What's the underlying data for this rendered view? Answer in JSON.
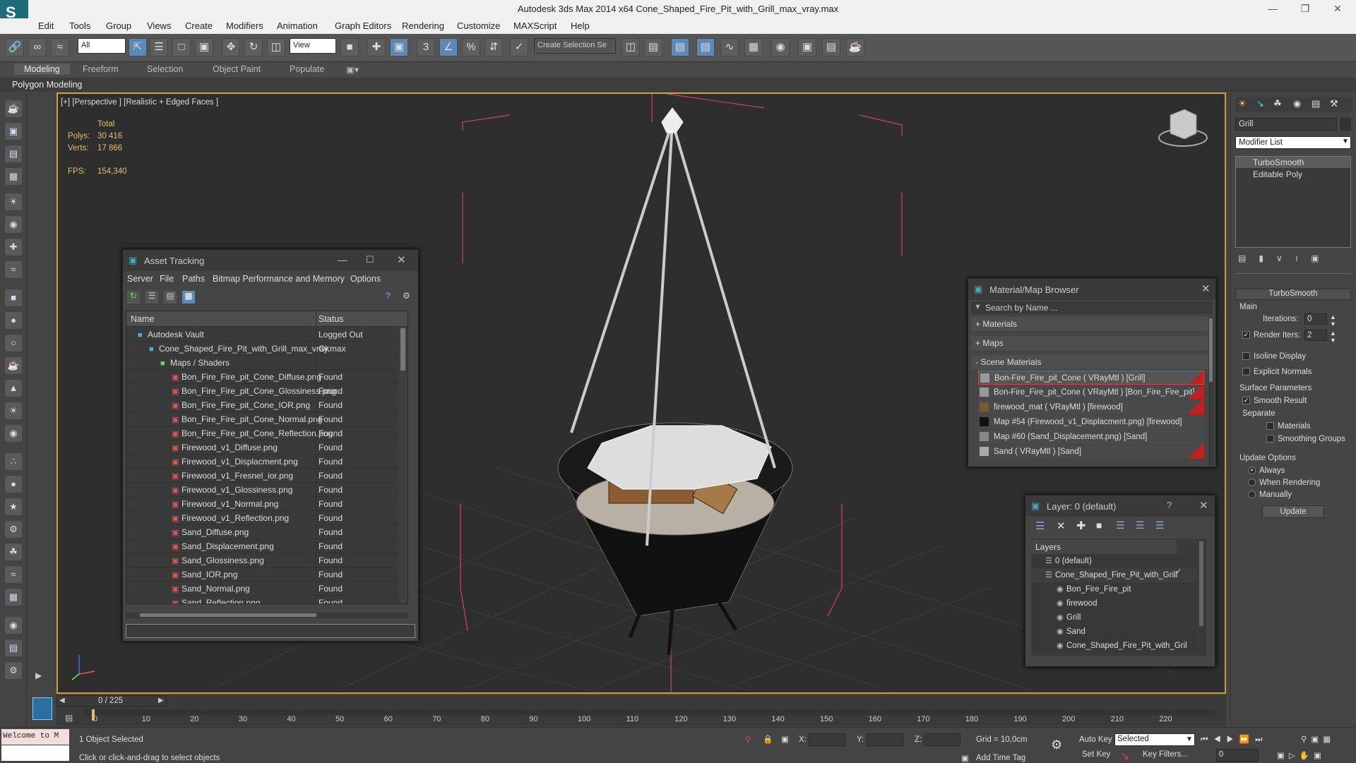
{
  "titlebar": {
    "title": "Autodesk 3ds Max  2014 x64     Cone_Shaped_Fire_Pit_with_Grill_max_vray.max"
  },
  "menubar": {
    "items": [
      "Edit",
      "Tools",
      "Group",
      "Views",
      "Create",
      "Modifiers",
      "Animation",
      "Graph Editors",
      "Rendering",
      "Customize",
      "MAXScript",
      "Help"
    ]
  },
  "toolbar": {
    "selection_filter": "All",
    "reference_coord": "View",
    "named_selection_placeholder": "Create Selection Se"
  },
  "ribbon": {
    "tabs": [
      "Modeling",
      "Freeform",
      "Selection",
      "Object Paint",
      "Populate"
    ],
    "subpanel": "Polygon Modeling"
  },
  "viewport": {
    "label": "[+] [Perspective ] [Realistic + Edged Faces ]",
    "stats": {
      "total_label": "Total",
      "polys_label": "Polys:",
      "polys": "30 416",
      "verts_label": "Verts:",
      "verts": "17 866",
      "fps_label": "FPS:",
      "fps": "154,340"
    }
  },
  "asset_tracking": {
    "title": "Asset Tracking",
    "menu": [
      "Server",
      "File",
      "Paths",
      "Bitmap Performance and Memory",
      "Options"
    ],
    "columns": [
      "Name",
      "Status"
    ],
    "rows": [
      {
        "name": "Autodesk Vault",
        "status": "Logged Out",
        "indent": 1
      },
      {
        "name": "Cone_Shaped_Fire_Pit_with_Grill_max_vray.max",
        "status": "Ok",
        "indent": 2
      },
      {
        "name": "Maps / Shaders",
        "status": "",
        "indent": 3
      },
      {
        "name": "Bon_Fire_Fire_pit_Cone_Diffuse.png",
        "status": "Found",
        "indent": 4
      },
      {
        "name": "Bon_Fire_Fire_pit_Cone_Glossiness.png",
        "status": "Found",
        "indent": 4
      },
      {
        "name": "Bon_Fire_Fire_pit_Cone_IOR.png",
        "status": "Found",
        "indent": 4
      },
      {
        "name": "Bon_Fire_Fire_pit_Cone_Normal.png",
        "status": "Found",
        "indent": 4
      },
      {
        "name": "Bon_Fire_Fire_pit_Cone_Reflection.png",
        "status": "Found",
        "indent": 4
      },
      {
        "name": "Firewood_v1_Diffuse.png",
        "status": "Found",
        "indent": 4
      },
      {
        "name": "Firewood_v1_Displacment.png",
        "status": "Found",
        "indent": 4
      },
      {
        "name": "Firewood_v1_Fresnel_ior.png",
        "status": "Found",
        "indent": 4
      },
      {
        "name": "Firewood_v1_Glossiness.png",
        "status": "Found",
        "indent": 4
      },
      {
        "name": "Firewood_v1_Normal.png",
        "status": "Found",
        "indent": 4
      },
      {
        "name": "Firewood_v1_Reflection.png",
        "status": "Found",
        "indent": 4
      },
      {
        "name": "Sand_Diffuse.png",
        "status": "Found",
        "indent": 4
      },
      {
        "name": "Sand_Displacement.png",
        "status": "Found",
        "indent": 4
      },
      {
        "name": "Sand_Glossiness.png",
        "status": "Found",
        "indent": 4
      },
      {
        "name": "Sand_IOR.png",
        "status": "Found",
        "indent": 4
      },
      {
        "name": "Sand_Normal.png",
        "status": "Found",
        "indent": 4
      },
      {
        "name": "Sand_Reflection.png",
        "status": "Found",
        "indent": 4
      }
    ]
  },
  "material_browser": {
    "title": "Material/Map Browser",
    "search_placeholder": "Search by Name ...",
    "sections": [
      "+ Materials",
      "+ Maps",
      "- Scene Materials"
    ],
    "items": [
      "Bon-Fire_Fire_pit_Cone  ( VRayMtl )  [Grill]",
      "Bon-Fire_Fire_pit_Cone  ( VRayMtl )  [Bon_Fire_Fire_pit]",
      "firewood_mat  ( VRayMtl )  [firewood]",
      "Map #54 (Firewood_v1_Displacment.png) [firewood]",
      "Map #60 (Sand_Displacement.png) [Sand]",
      "Sand  ( VRayMtl )  [Sand]"
    ]
  },
  "layer_panel": {
    "title": "Layer: 0 (default)",
    "help": "?",
    "header": "Layers",
    "items": [
      {
        "name": "0 (default)",
        "indent": 1
      },
      {
        "name": "Cone_Shaped_Fire_Pit_with_Grill",
        "indent": 1
      },
      {
        "name": "Bon_Fire_Fire_pit",
        "indent": 2
      },
      {
        "name": "firewood",
        "indent": 2
      },
      {
        "name": "Grill",
        "indent": 2
      },
      {
        "name": "Sand",
        "indent": 2
      },
      {
        "name": "Cone_Shaped_Fire_Pit_with_Gril",
        "indent": 2
      }
    ]
  },
  "command_panel": {
    "object_name": "Grill",
    "modifier_list": "Modifier List",
    "stack": [
      "TurboSmooth",
      "Editable Poly"
    ],
    "rollout_title": "TurboSmooth",
    "main_label": "Main",
    "iterations_label": "Iterations:",
    "iterations": "0",
    "render_iters_label": "Render Iters:",
    "render_iters": "2",
    "isoline_label": "Isoline Display",
    "explicit_normals_label": "Explicit Normals",
    "surface_params_label": "Surface Parameters",
    "smooth_result_label": "Smooth Result",
    "separate_label": "Separate",
    "materials_label": "Materials",
    "smoothing_groups_label": "Smoothing Groups",
    "update_options_label": "Update Options",
    "always_label": "Always",
    "when_rendering_label": "When Rendering",
    "manually_label": "Manually",
    "update_button": "Update"
  },
  "timeline": {
    "frame_counter": "0 / 225",
    "ticks": [
      "0",
      "10",
      "20",
      "30",
      "40",
      "50",
      "60",
      "70",
      "80",
      "90",
      "100",
      "110",
      "120",
      "130",
      "140",
      "150",
      "160",
      "170",
      "180",
      "190",
      "200",
      "210",
      "220"
    ]
  },
  "statusbar": {
    "script_listener": "Welcome to M",
    "selection_status": "1 Object Selected",
    "prompt": "Click or click-and-drag to select objects",
    "x_label": "X:",
    "y_label": "Y:",
    "z_label": "Z:",
    "grid": "Grid = 10,0cm",
    "add_time_tag": "Add Time Tag",
    "auto_key": "Auto Key",
    "auto_key_value": "Selected",
    "set_key": "Set Key",
    "key_filters": "Key Filters...",
    "current_frame": "0"
  }
}
